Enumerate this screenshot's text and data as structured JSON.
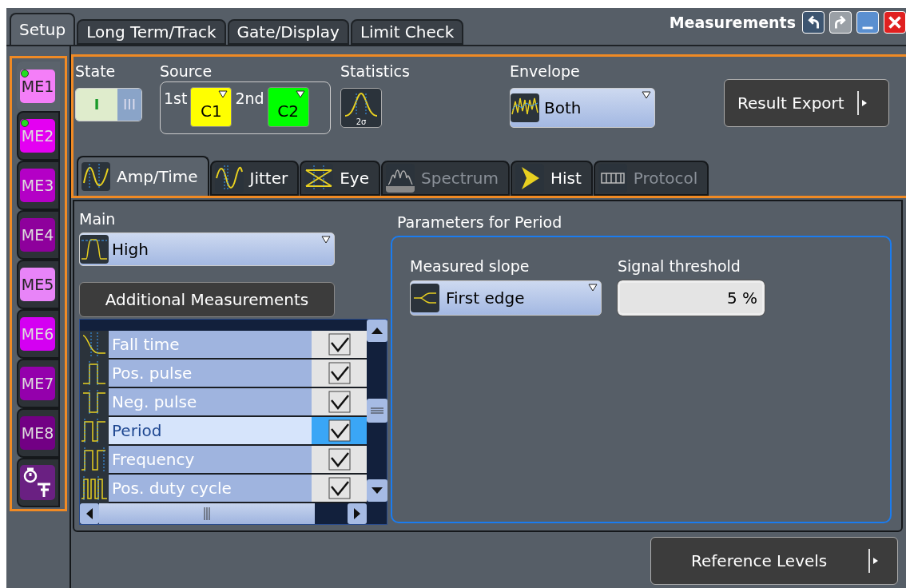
{
  "window": {
    "title": "Measurements"
  },
  "title_buttons": [
    {
      "kind": "undo",
      "disabled": false
    },
    {
      "kind": "redo",
      "disabled": true
    },
    {
      "kind": "minimize",
      "disabled": false
    },
    {
      "kind": "close",
      "disabled": false
    }
  ],
  "tabs": [
    {
      "label": "Setup",
      "selected": true
    },
    {
      "label": "Long Term/Track",
      "selected": false
    },
    {
      "label": "Gate/Display",
      "selected": false
    },
    {
      "label": "Limit Check",
      "selected": false
    }
  ],
  "measurement_tabs": [
    {
      "label": "ME1",
      "selected": true,
      "on": true,
      "color": "#f47ef8"
    },
    {
      "label": "ME2",
      "selected": false,
      "on": true,
      "color": "#e400f2"
    },
    {
      "label": "ME3",
      "selected": false,
      "on": false,
      "color": "#b400c6"
    },
    {
      "label": "ME4",
      "selected": false,
      "on": false,
      "color": "#8e009c"
    },
    {
      "label": "ME5",
      "selected": false,
      "on": false,
      "color": "#e884f8"
    },
    {
      "label": "ME6",
      "selected": false,
      "on": false,
      "color": "#d400f2"
    },
    {
      "label": "ME7",
      "selected": false,
      "on": false,
      "color": "#9400ac"
    },
    {
      "label": "ME8",
      "selected": false,
      "on": false,
      "color": "#720084"
    }
  ],
  "timing_tab": {
    "selected": false
  },
  "state": {
    "label": "State",
    "on": true,
    "on_label": "I",
    "off_label": "III"
  },
  "source": {
    "label": "Source",
    "first": {
      "label": "1st",
      "value": "C1",
      "color": "#ffff00"
    },
    "second": {
      "label": "2nd",
      "value": "C2",
      "color": "#00ff00"
    }
  },
  "statistics": {
    "label": "Statistics",
    "icon_label": "2σ"
  },
  "envelope": {
    "label": "Envelope",
    "value": "Both"
  },
  "result_export": {
    "label": "Result Export"
  },
  "function_tabs": [
    {
      "label": "Amp/Time",
      "selected": true,
      "disabled": false
    },
    {
      "label": "Jitter",
      "selected": false,
      "disabled": false
    },
    {
      "label": "Eye",
      "selected": false,
      "disabled": false
    },
    {
      "label": "Spectrum",
      "selected": false,
      "disabled": true
    },
    {
      "label": "Hist",
      "selected": false,
      "disabled": false
    },
    {
      "label": "Protocol",
      "selected": false,
      "disabled": true
    }
  ],
  "main": {
    "label": "Main",
    "value": "High"
  },
  "additional_measurements": {
    "label": "Additional Measurements"
  },
  "measurements": [
    {
      "label": "Fall time",
      "checked": true,
      "selected": false
    },
    {
      "label": "Pos. pulse",
      "checked": true,
      "selected": false
    },
    {
      "label": "Neg. pulse",
      "checked": true,
      "selected": false
    },
    {
      "label": "Period",
      "checked": true,
      "selected": true
    },
    {
      "label": "Frequency",
      "checked": true,
      "selected": false
    },
    {
      "label": "Pos. duty cycle",
      "checked": true,
      "selected": false
    }
  ],
  "parameters": {
    "title": "Parameters for Period",
    "slope": {
      "label": "Measured slope",
      "value": "First edge"
    },
    "threshold": {
      "label": "Signal threshold",
      "value": "5 %"
    }
  },
  "reference_levels": {
    "label": "Reference Levels"
  }
}
